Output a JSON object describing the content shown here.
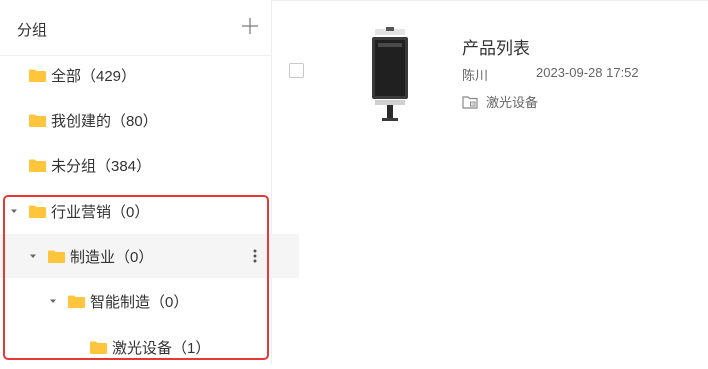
{
  "sidebar": {
    "title": "分组",
    "add_label": "+",
    "items": [
      {
        "label": "全部（429）"
      },
      {
        "label": "我创建的（80）"
      },
      {
        "label": "未分组（384）"
      },
      {
        "label": "行业营销（0）",
        "expanded": true
      },
      {
        "label": "制造业（0）",
        "expanded": true,
        "selected": true
      },
      {
        "label": "智能制造（0）",
        "expanded": true
      },
      {
        "label": "激光设备（1）"
      }
    ]
  },
  "card": {
    "title": "产品列表",
    "author": "陈川",
    "date": "2023-09-28 17:52",
    "group": "激光设备",
    "checked": false
  },
  "colors": {
    "folder": "#ffc53d",
    "highlight": "#e53935",
    "selected_bg": "#f5f5f5"
  },
  "icons": {
    "add": "plus-icon",
    "folder": "folder-icon",
    "caret": "caret-down-icon",
    "more": "more-vertical-icon",
    "group": "folder-outline-icon"
  }
}
